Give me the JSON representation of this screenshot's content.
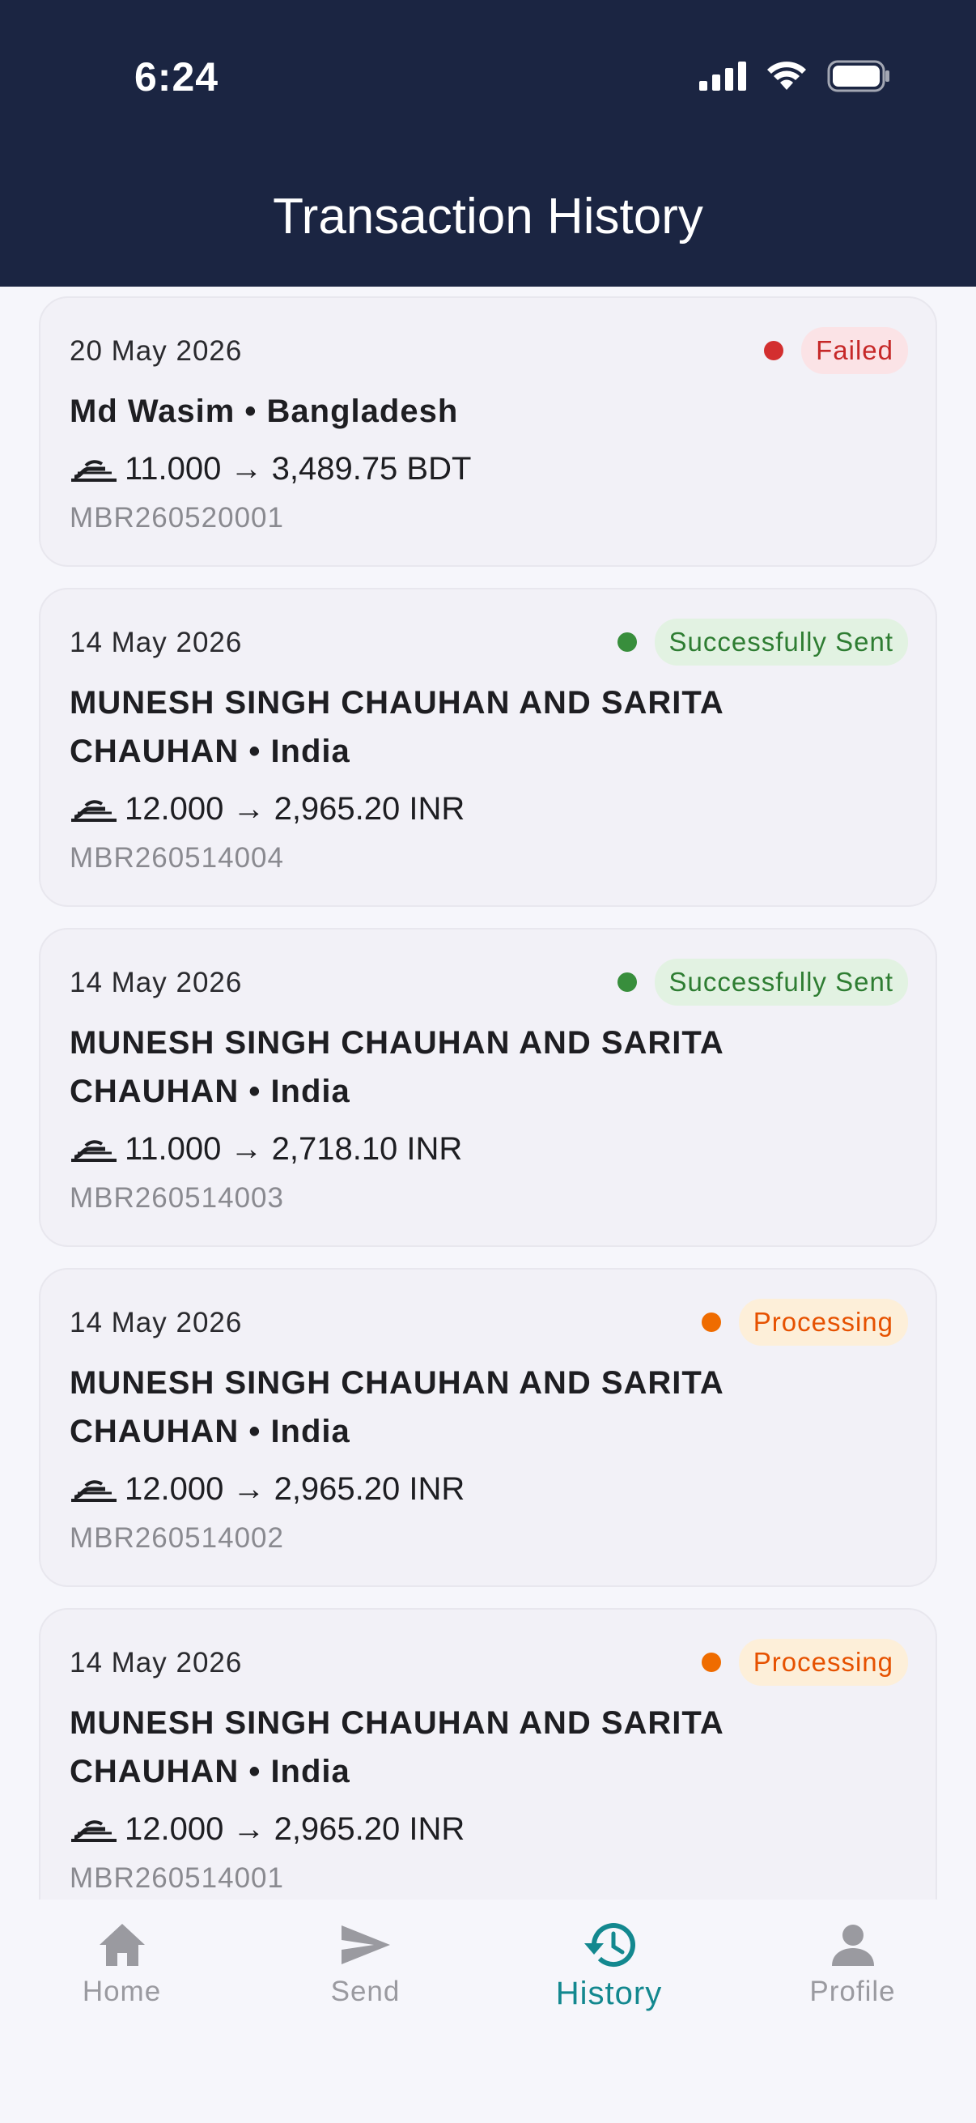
{
  "status_bar": {
    "time": "6:24"
  },
  "header": {
    "title": "Transaction History"
  },
  "colors": {
    "header_bg": "#1b2542",
    "failed": "#d32f2f",
    "success": "#388e3c",
    "processing": "#ef6c00",
    "active_tab": "#13888f"
  },
  "transactions": [
    {
      "date": "20 May 2026",
      "status": "Failed",
      "recipient": "Md Wasim • Bangladesh",
      "amount": "11.000 → 3,489.75 BDT",
      "reference": "MBR260520001"
    },
    {
      "date": "14 May 2026",
      "status": "Successfully Sent",
      "recipient": "MUNESH SINGH CHAUHAN AND SARITA CHAUHAN • India",
      "amount": "12.000 → 2,965.20 INR",
      "reference": "MBR260514004"
    },
    {
      "date": "14 May 2026",
      "status": "Successfully Sent",
      "recipient": "MUNESH SINGH CHAUHAN AND SARITA CHAUHAN • India",
      "amount": "11.000 → 2,718.10 INR",
      "reference": "MBR260514003"
    },
    {
      "date": "14 May 2026",
      "status": "Processing",
      "recipient": "MUNESH SINGH CHAUHAN AND SARITA CHAUHAN • India",
      "amount": "12.000 → 2,965.20 INR",
      "reference": "MBR260514002"
    },
    {
      "date": "14 May 2026",
      "status": "Processing",
      "recipient": "MUNESH SINGH CHAUHAN AND SARITA CHAUHAN • India",
      "amount": "12.000 → 2,965.20 INR",
      "reference": "MBR260514001"
    }
  ],
  "tabbar": {
    "items": [
      {
        "label": "Home",
        "icon": "home-icon"
      },
      {
        "label": "Send",
        "icon": "send-icon"
      },
      {
        "label": "History",
        "icon": "history-icon",
        "active": true
      },
      {
        "label": "Profile",
        "icon": "profile-icon"
      }
    ]
  }
}
